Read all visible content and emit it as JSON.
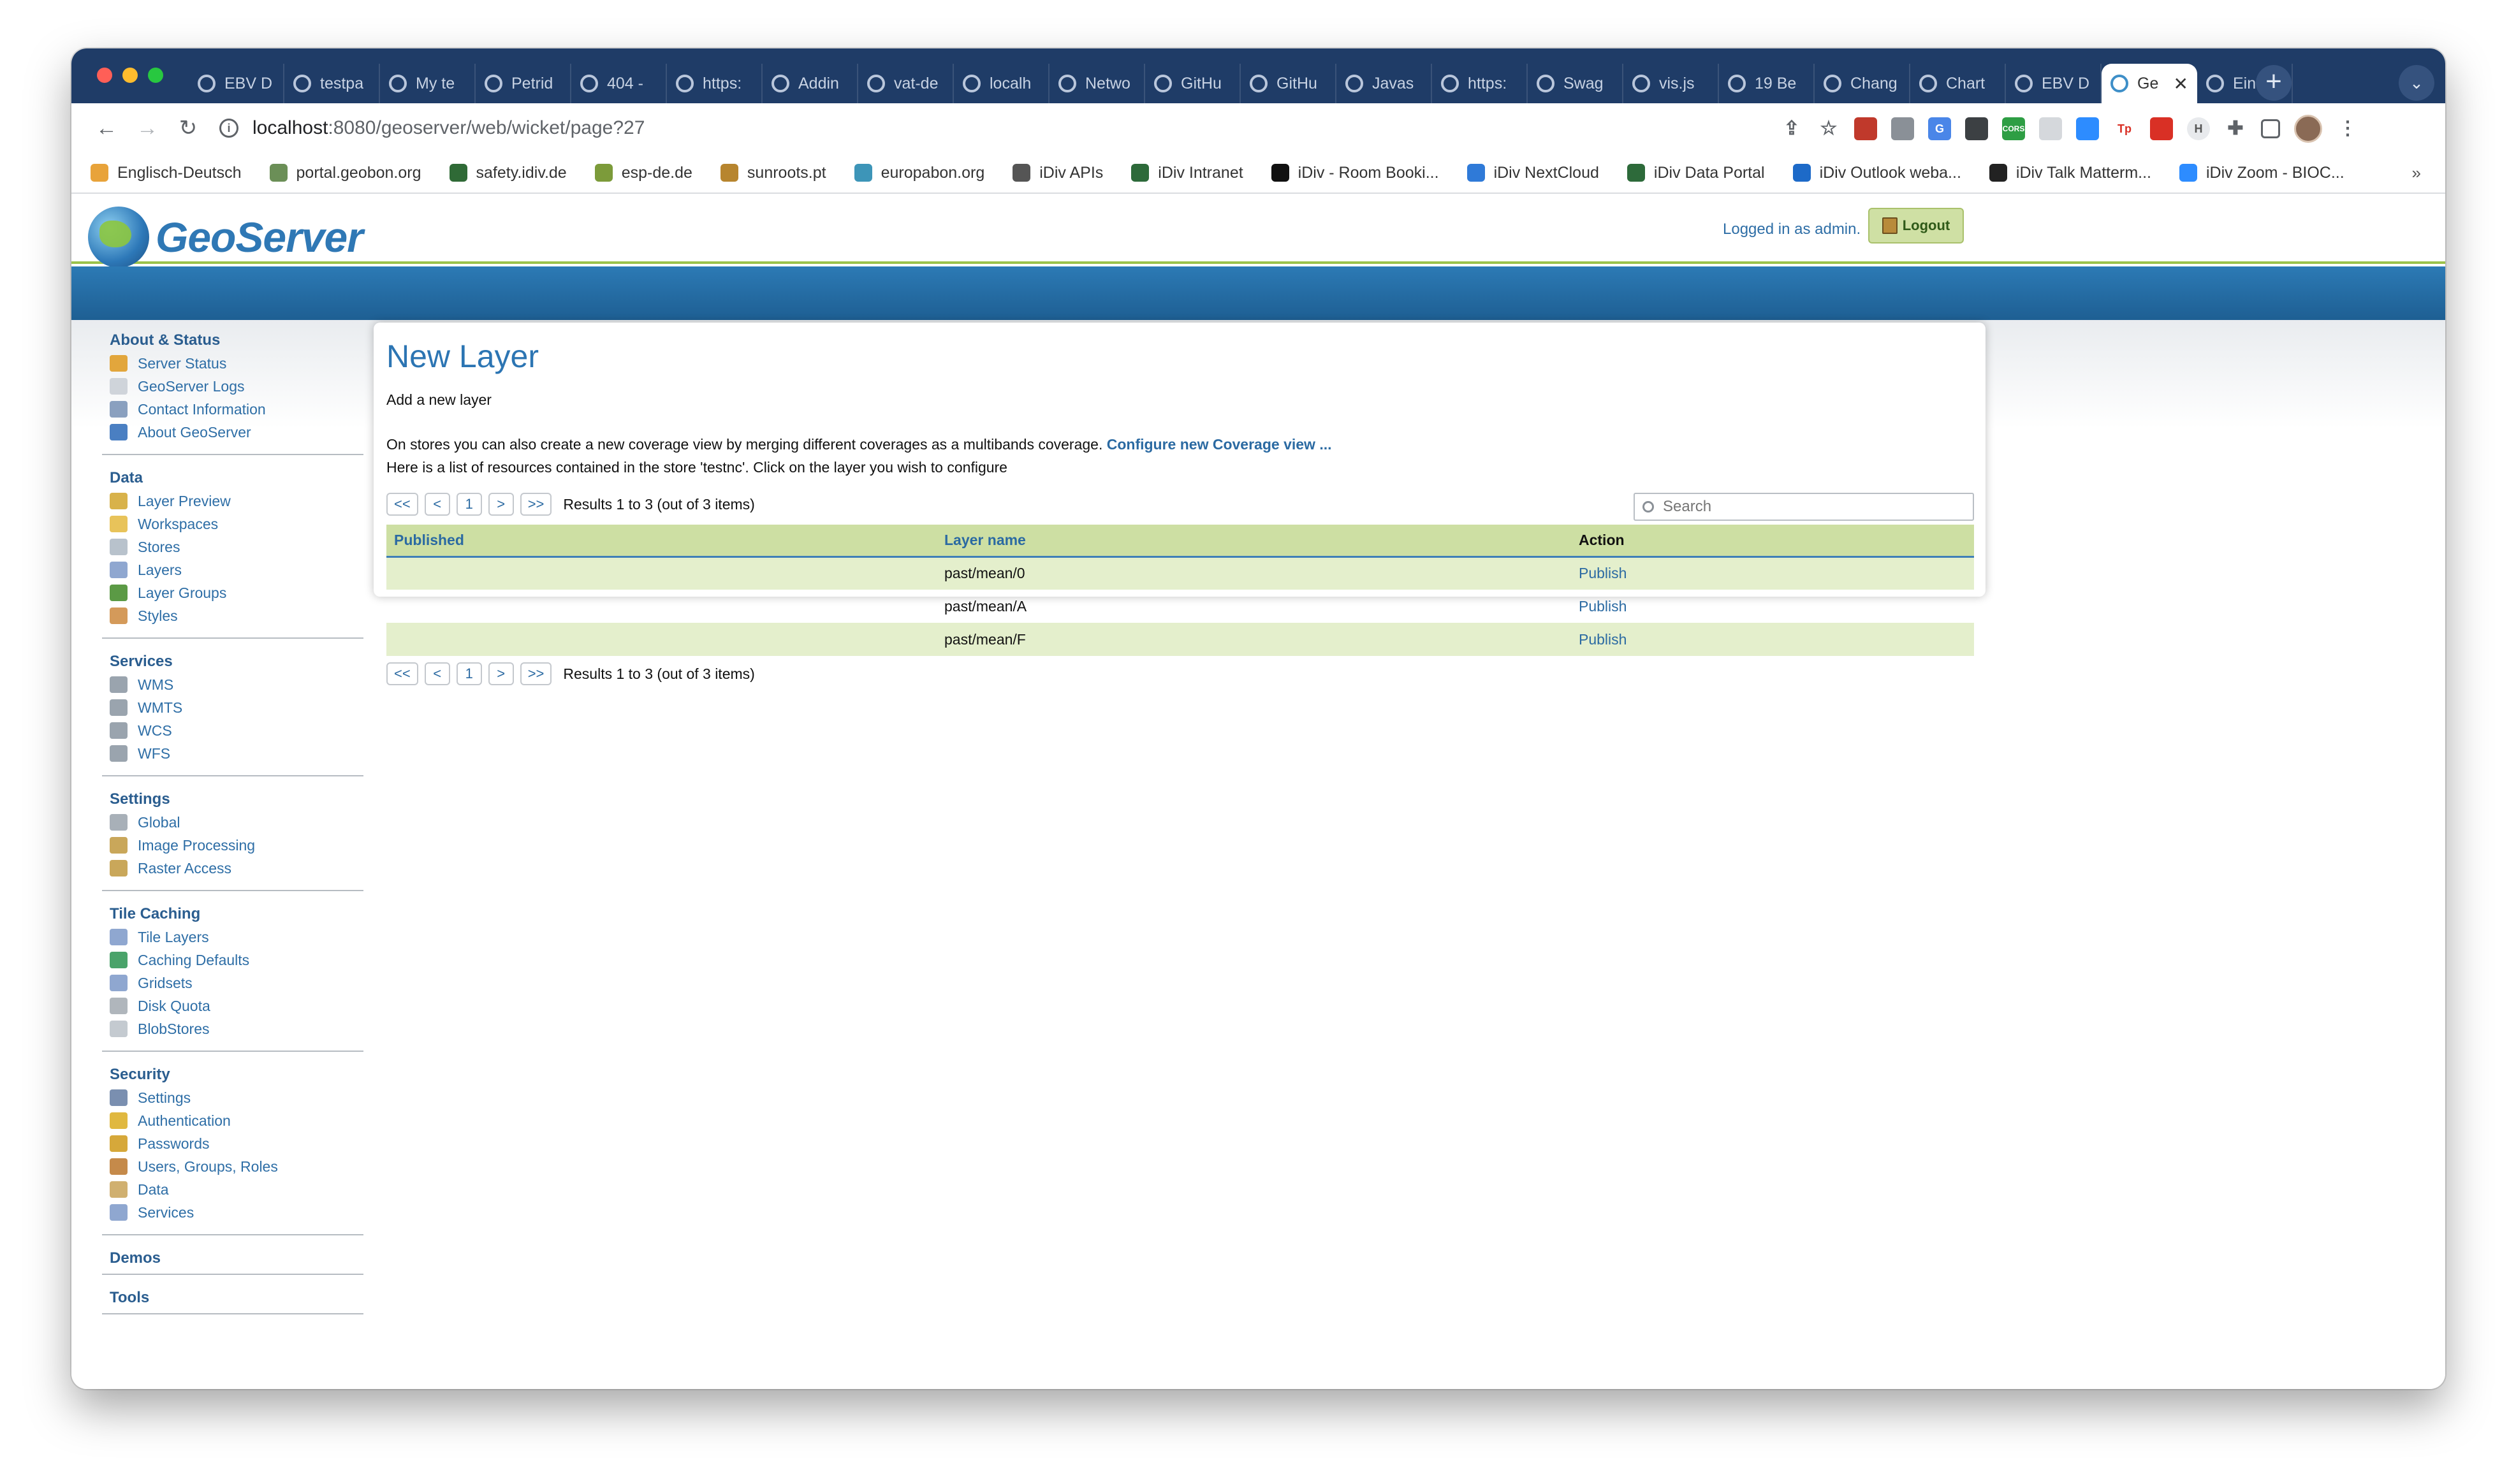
{
  "browser": {
    "tabs": [
      {
        "label": "EBV D"
      },
      {
        "label": "testpa"
      },
      {
        "label": "My te"
      },
      {
        "label": "Petrid"
      },
      {
        "label": "404 -"
      },
      {
        "label": "https:"
      },
      {
        "label": "Addin"
      },
      {
        "label": "vat-de"
      },
      {
        "label": "localh"
      },
      {
        "label": "Netwo"
      },
      {
        "label": "GitHu"
      },
      {
        "label": "GitHu"
      },
      {
        "label": "Javas"
      },
      {
        "label": "https:"
      },
      {
        "label": "Swag"
      },
      {
        "label": "vis.js"
      },
      {
        "label": "19 Be"
      },
      {
        "label": "Chang"
      },
      {
        "label": "Chart"
      },
      {
        "label": "EBV D"
      },
      {
        "label": "Ge",
        "active": true
      },
      {
        "label": "Einste"
      }
    ],
    "url_host": "localhost",
    "url_path": ":8080/geoserver/web/wicket/page?27",
    "bookmarks": [
      {
        "label": "Englisch-Deutsch",
        "color": "#e8a33a"
      },
      {
        "label": "portal.geobon.org",
        "color": "#6b8f57"
      },
      {
        "label": "safety.idiv.de",
        "color": "#2f6a36"
      },
      {
        "label": "esp-de.de",
        "color": "#7c9b3a"
      },
      {
        "label": "sunroots.pt",
        "color": "#b7852e"
      },
      {
        "label": "europabon.org",
        "color": "#3d95b8"
      },
      {
        "label": "iDiv APIs",
        "color": "#555555"
      },
      {
        "label": "iDiv Intranet",
        "color": "#2d6a3a"
      },
      {
        "label": "iDiv - Room Booki...",
        "color": "#111111"
      },
      {
        "label": "iDiv NextCloud",
        "color": "#2f7ad8"
      },
      {
        "label": "iDiv Data Portal",
        "color": "#2d6a3a"
      },
      {
        "label": "iDiv Outlook weba...",
        "color": "#1d6ac8"
      },
      {
        "label": "iDiv Talk Matterm...",
        "color": "#222222"
      },
      {
        "label": "iDiv Zoom - BIOC...",
        "color": "#2d8cff"
      }
    ],
    "bookmarks_more": "»"
  },
  "header": {
    "logo_text": "GeoServer",
    "logged_in": "Logged in as admin.",
    "logout_label": "Logout"
  },
  "sidebar": {
    "sections": [
      {
        "title": "About & Status",
        "items": [
          {
            "label": "Server Status",
            "icon": "server-status-icon",
            "color": "#e2a63c"
          },
          {
            "label": "GeoServer Logs",
            "icon": "logs-icon",
            "color": "#cfd4da"
          },
          {
            "label": "Contact Information",
            "icon": "contact-icon",
            "color": "#8aa0bf"
          },
          {
            "label": "About GeoServer",
            "icon": "about-icon",
            "color": "#4a7fc2"
          }
        ]
      },
      {
        "title": "Data",
        "items": [
          {
            "label": "Layer Preview",
            "icon": "layer-preview-icon",
            "color": "#d8b24a"
          },
          {
            "label": "Workspaces",
            "icon": "workspaces-icon",
            "color": "#e8c35a"
          },
          {
            "label": "Stores",
            "icon": "stores-icon",
            "color": "#b8c2cc"
          },
          {
            "label": "Layers",
            "icon": "layers-icon",
            "color": "#8fa7d0"
          },
          {
            "label": "Layer Groups",
            "icon": "layer-groups-icon",
            "color": "#5b9a45"
          },
          {
            "label": "Styles",
            "icon": "styles-icon",
            "color": "#d49a5a"
          }
        ]
      },
      {
        "title": "Services",
        "items": [
          {
            "label": "WMS",
            "icon": "wms-icon",
            "color": "#9aa4ae"
          },
          {
            "label": "WMTS",
            "icon": "wmts-icon",
            "color": "#9aa4ae"
          },
          {
            "label": "WCS",
            "icon": "wcs-icon",
            "color": "#9aa4ae"
          },
          {
            "label": "WFS",
            "icon": "wfs-icon",
            "color": "#9aa4ae"
          }
        ]
      },
      {
        "title": "Settings",
        "items": [
          {
            "label": "Global",
            "icon": "global-icon",
            "color": "#a8b0b8"
          },
          {
            "label": "Image Processing",
            "icon": "image-processing-icon",
            "color": "#c9a75a"
          },
          {
            "label": "Raster Access",
            "icon": "raster-access-icon",
            "color": "#c9a75a"
          }
        ]
      },
      {
        "title": "Tile Caching",
        "items": [
          {
            "label": "Tile Layers",
            "icon": "tile-layers-icon",
            "color": "#8fa7d0"
          },
          {
            "label": "Caching Defaults",
            "icon": "caching-defaults-icon",
            "color": "#4aa36a"
          },
          {
            "label": "Gridsets",
            "icon": "gridsets-icon",
            "color": "#8fa7d0"
          },
          {
            "label": "Disk Quota",
            "icon": "disk-quota-icon",
            "color": "#b0b6bc"
          },
          {
            "label": "BlobStores",
            "icon": "blobstores-icon",
            "color": "#c4cad0"
          }
        ]
      },
      {
        "title": "Security",
        "items": [
          {
            "label": "Settings",
            "icon": "security-settings-icon",
            "color": "#7a8fb0"
          },
          {
            "label": "Authentication",
            "icon": "authentication-icon",
            "color": "#e0b840"
          },
          {
            "label": "Passwords",
            "icon": "passwords-icon",
            "color": "#d6a83a"
          },
          {
            "label": "Users, Groups, Roles",
            "icon": "users-icon",
            "color": "#c58a4a"
          },
          {
            "label": "Data",
            "icon": "security-data-icon",
            "color": "#d0b070"
          },
          {
            "label": "Services",
            "icon": "security-services-icon",
            "color": "#8fa7d0"
          }
        ]
      },
      {
        "title": "Demos",
        "items": []
      },
      {
        "title": "Tools",
        "items": []
      }
    ]
  },
  "main": {
    "title": "New Layer",
    "subtitle": "Add a new layer",
    "desc_line1": "On stores you can also create a new coverage view by merging different coverages as a multibands coverage.",
    "configure_link": "Configure new Coverage view ...",
    "desc_line2": "Here is a list of resources contained in the store 'testnc'. Click on the layer you wish to configure",
    "pager": {
      "first": "<<",
      "prev": "<",
      "page": "1",
      "next": ">",
      "last": ">>",
      "results": "Results 1 to 3 (out of 3 items)"
    },
    "search_placeholder": "Search",
    "table": {
      "headers": {
        "published": "Published",
        "layer_name": "Layer name",
        "action": "Action"
      },
      "rows": [
        {
          "published": "",
          "layer_name": "past/mean/0",
          "action": "Publish"
        },
        {
          "published": "",
          "layer_name": "past/mean/A",
          "action": "Publish"
        },
        {
          "published": "",
          "layer_name": "past/mean/F",
          "action": "Publish"
        }
      ]
    }
  }
}
